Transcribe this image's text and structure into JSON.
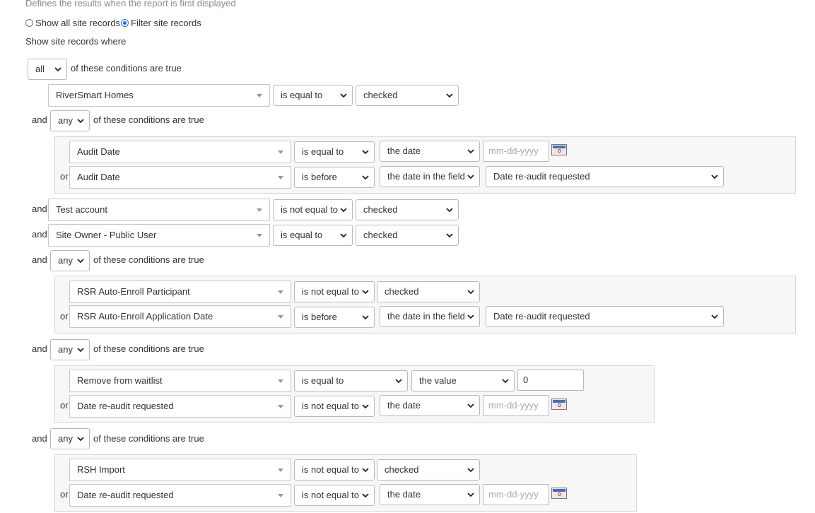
{
  "header": {
    "description": "Defines the results when the report is first displayed",
    "radio_all_label": "Show all site records",
    "radio_filter_label": "Filter site records",
    "show_where": "Show site records where"
  },
  "conditions_suffix": "of these conditions are true",
  "connectors": {
    "and": "and",
    "or": "or"
  },
  "root_quantifier": "all",
  "rows": {
    "r1": {
      "field": "RiverSmart Homes",
      "operator": "is equal to",
      "value_type": "checked"
    },
    "g1_quantifier": "any",
    "g1a": {
      "field": "Audit Date",
      "operator": "is equal to",
      "value_type": "the date",
      "date_placeholder": "mm-dd-yyyy"
    },
    "g1b": {
      "field": "Audit Date",
      "operator": "is before",
      "value_type": "the date in the field",
      "field_ref": "Date re-audit requested"
    },
    "r2": {
      "field": "Test account",
      "operator": "is not equal to",
      "value_type": "checked"
    },
    "r3": {
      "field": "Site Owner - Public User",
      "operator": "is equal to",
      "value_type": "checked"
    },
    "g2_quantifier": "any",
    "g2a": {
      "field": "RSR Auto-Enroll Participant",
      "operator": "is not equal to",
      "value_type": "checked"
    },
    "g2b": {
      "field": "RSR Auto-Enroll Application Date",
      "operator": "is before",
      "value_type": "the date in the field",
      "field_ref": "Date re-audit requested"
    },
    "g3_quantifier": "any",
    "g3a": {
      "field": "Remove from waitlist",
      "operator": "is equal to",
      "value_type": "the value",
      "value": "0"
    },
    "g3b": {
      "field": "Date re-audit requested",
      "operator": "is not equal to",
      "value_type": "the date",
      "date_placeholder": "mm-dd-yyyy"
    },
    "g4_quantifier": "any",
    "g4a": {
      "field": "RSH Import",
      "operator": "is not equal to",
      "value_type": "checked"
    },
    "g4b": {
      "field": "Date re-audit requested",
      "operator": "is not equal to",
      "value_type": "the date",
      "date_placeholder": "mm-dd-yyyy"
    }
  },
  "icons": {
    "calendar": "calendar-icon",
    "dropdown": "chevron-down-icon"
  }
}
